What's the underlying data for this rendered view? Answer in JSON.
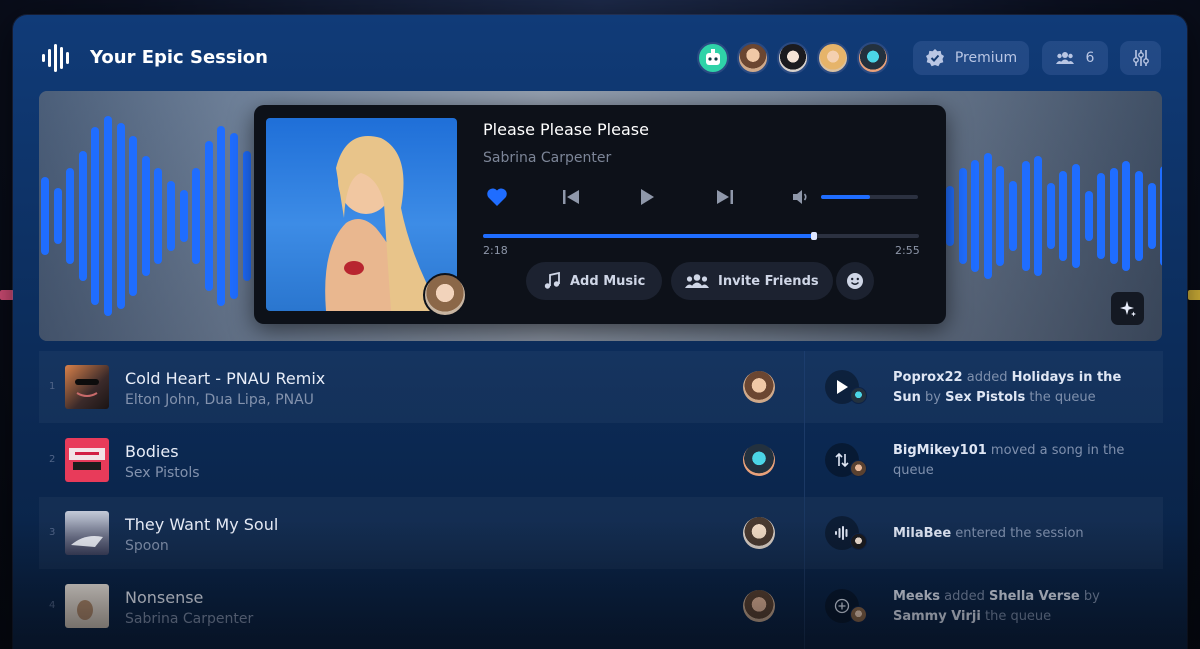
{
  "header": {
    "title": "Your Epic Session",
    "premium_label": "Premium",
    "member_count": "6"
  },
  "player": {
    "song_title": "Please Please Please",
    "artist": "Sabrina Carpenter",
    "current_time": "2:18",
    "total_time": "2:55",
    "progress_fraction": 0.76,
    "volume_fraction": 0.5,
    "liked": true,
    "add_music_label": "Add Music",
    "invite_friends_label": "Invite Friends"
  },
  "queue": [
    {
      "num": "1",
      "title": "Cold Heart - PNAU Remix",
      "artist": "Elton John, Dua Lipa, PNAU"
    },
    {
      "num": "2",
      "title": "Bodies",
      "artist": "Sex Pistols"
    },
    {
      "num": "3",
      "title": "They Want My Soul",
      "artist": "Spoon"
    },
    {
      "num": "4",
      "title": "Nonsense",
      "artist": "Sabrina Carpenter"
    }
  ],
  "activity": [
    {
      "user": "Poprox22",
      "action": " added ",
      "song": "Holidays in the Sun",
      "by": " by ",
      "artist": "Sex Pistols",
      "tail": " the queue",
      "icon": "play-icon"
    },
    {
      "user": "BigMikey101",
      "action": " moved a song in the queue",
      "icon": "reorder-icon"
    },
    {
      "user": "MilaBee",
      "action": " entered the session",
      "icon": "soundwave-icon"
    },
    {
      "user": "Meeks",
      "action": " added ",
      "song": "Shella Verse",
      "by": " by ",
      "artist": "Sammy Virji",
      "tail": " the queue",
      "icon": "add-circle-icon"
    }
  ],
  "colors": {
    "accent": "#1f6dff",
    "panel_top": "#103b78",
    "player_bg": "#0d1119"
  }
}
